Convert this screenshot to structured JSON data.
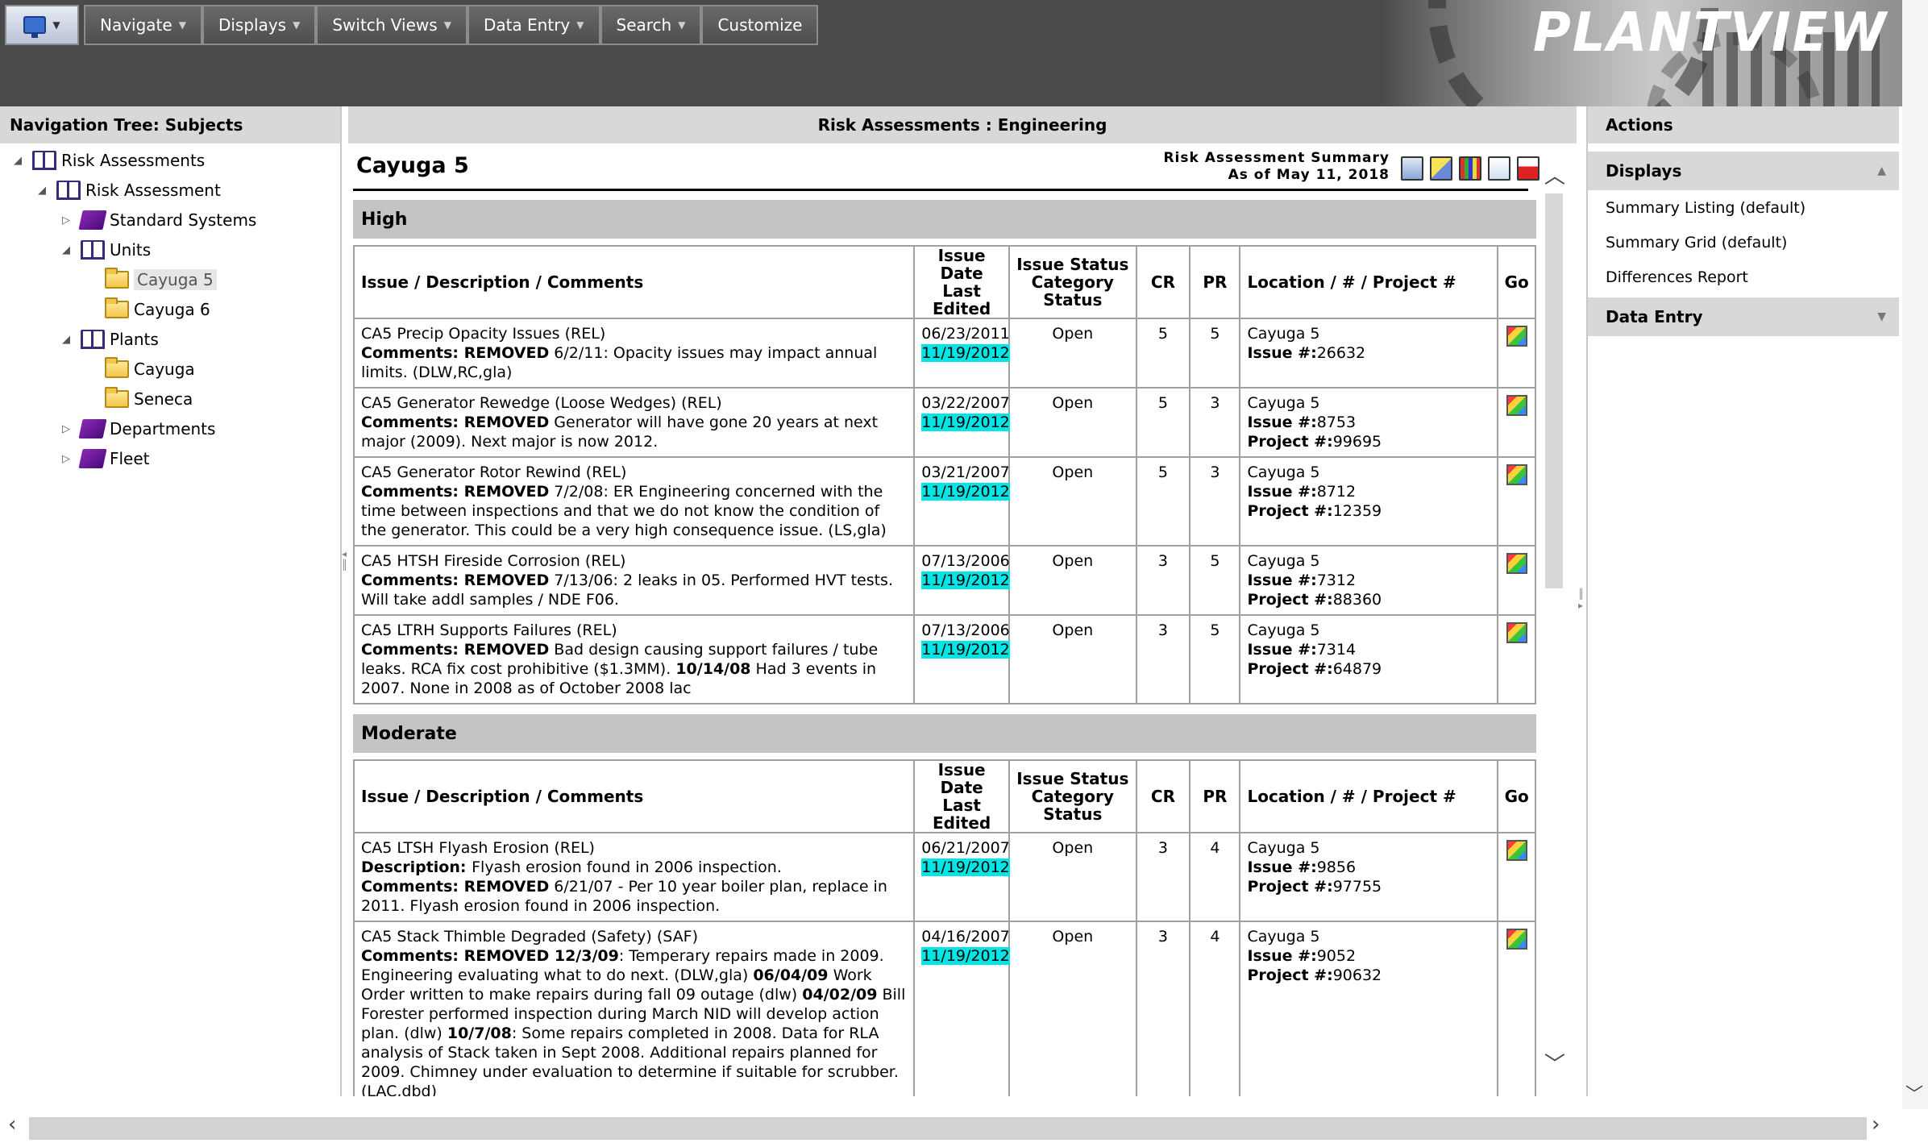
{
  "menu": {
    "items": [
      {
        "label": "Navigate",
        "arrow": true
      },
      {
        "label": "Displays",
        "arrow": true
      },
      {
        "label": "Switch Views",
        "arrow": true
      },
      {
        "label": "Data Entry",
        "arrow": true
      },
      {
        "label": "Search",
        "arrow": true
      },
      {
        "label": "Customize",
        "arrow": false
      }
    ]
  },
  "logo": "PLANTVIEW",
  "nav_tree": {
    "title": "Navigation Tree: Subjects",
    "nodes": [
      {
        "label": "Risk Assessments",
        "icon": "book-icon",
        "level": 0,
        "toggle": "expanded"
      },
      {
        "label": "Risk Assessment",
        "icon": "book-icon",
        "level": 1,
        "toggle": "expanded"
      },
      {
        "label": "Standard Systems",
        "icon": "purple-book-icon",
        "level": 2,
        "toggle": "collapsed"
      },
      {
        "label": "Units",
        "icon": "book-icon",
        "level": 2,
        "toggle": "expanded"
      },
      {
        "label": "Cayuga 5",
        "icon": "folder-icon",
        "level": 3,
        "toggle": "none",
        "selected": true
      },
      {
        "label": "Cayuga 6",
        "icon": "folder-icon",
        "level": 3,
        "toggle": "none"
      },
      {
        "label": "Plants",
        "icon": "book-icon",
        "level": 2,
        "toggle": "expanded"
      },
      {
        "label": "Cayuga",
        "icon": "folder-icon",
        "level": 3,
        "toggle": "none"
      },
      {
        "label": "Seneca",
        "icon": "folder-icon",
        "level": 3,
        "toggle": "none"
      },
      {
        "label": "Departments",
        "icon": "purple-book-icon",
        "level": 2,
        "toggle": "collapsed"
      },
      {
        "label": "Fleet",
        "icon": "purple-book-icon",
        "level": 2,
        "toggle": "collapsed"
      }
    ]
  },
  "center": {
    "title": "Risk Assessments : Engineering",
    "subject": "Cayuga 5",
    "summary_line1": "Risk Assessment Summary",
    "summary_line2": "As of May 11, 2018",
    "columns": {
      "issue": "Issue / Description / Comments",
      "date1": "Issue Date",
      "date2": "Last Edited",
      "status1": "Issue Status",
      "status2": "Category Status",
      "cr": "CR",
      "pr": "PR",
      "location": "Location / # / Project #",
      "go": "Go"
    },
    "groups": [
      {
        "name": "High",
        "rows": [
          {
            "issue": "CA5 Precip Opacity Issues (REL)",
            "lines": [
              [
                {
                  "b": "Comments: "
                },
                {
                  "b": "REMOVED"
                },
                {
                  "t": " 6/2/11: Opacity issues may impact annual limits. (DLW,RC,gla)"
                }
              ]
            ],
            "issue_date": "06/23/2011",
            "last_edited": "11/19/2012",
            "status": "Open",
            "cr": "5",
            "pr": "5",
            "location": "Cayuga 5",
            "issue_no": "26632",
            "project_no": ""
          },
          {
            "issue": "CA5 Generator Rewedge (Loose Wedges) (REL)",
            "lines": [
              [
                {
                  "b": "Comments: "
                },
                {
                  "b": "REMOVED"
                },
                {
                  "t": " Generator will have gone 20 years at next major (2009).  Next major is now 2012."
                }
              ]
            ],
            "issue_date": "03/22/2007",
            "last_edited": "11/19/2012",
            "status": "Open",
            "cr": "5",
            "pr": "3",
            "location": "Cayuga 5",
            "issue_no": "8753",
            "project_no": "99695"
          },
          {
            "issue": "CA5 Generator Rotor Rewind (REL)",
            "lines": [
              [
                {
                  "b": "Comments: "
                },
                {
                  "b": "REMOVED"
                },
                {
                  "t": "  7/2/08: ER Engineering concerned with the time between inspections and that we do not know the condition of the generator. This could be a very high consequence issue. (LS,gla)"
                }
              ]
            ],
            "issue_date": "03/21/2007",
            "last_edited": "11/19/2012",
            "status": "Open",
            "cr": "5",
            "pr": "3",
            "location": "Cayuga 5",
            "issue_no": "8712",
            "project_no": "12359"
          },
          {
            "issue": "CA5 HTSH Fireside Corrosion (REL)",
            "lines": [
              [
                {
                  "b": "Comments: "
                },
                {
                  "b": "REMOVED"
                },
                {
                  "t": " 7/13/06: 2 leaks in 05. Performed HVT tests. Will take addl samples / NDE F06."
                }
              ]
            ],
            "issue_date": "07/13/2006",
            "last_edited": "11/19/2012",
            "status": "Open",
            "cr": "3",
            "pr": "5",
            "location": "Cayuga 5",
            "issue_no": "7312",
            "project_no": "88360"
          },
          {
            "issue": "CA5 LTRH Supports Failures (REL)",
            "lines": [
              [
                {
                  "b": "Comments: "
                },
                {
                  "b": "REMOVED"
                },
                {
                  "t": " Bad design causing support failures / tube leaks. RCA fix cost prohibitive ($1.3MM).  "
                },
                {
                  "b": "10/14/08"
                },
                {
                  "t": " Had 3 events in 2007. None in 2008 as of October 2008 lac"
                }
              ]
            ],
            "issue_date": "07/13/2006",
            "last_edited": "11/19/2012",
            "status": "Open",
            "cr": "3",
            "pr": "5",
            "location": "Cayuga 5",
            "issue_no": "7314",
            "project_no": "64879"
          }
        ]
      },
      {
        "name": "Moderate",
        "rows": [
          {
            "issue": "CA5 LTSH Flyash Erosion (REL)",
            "lines": [
              [
                {
                  "b": "Description: "
                },
                {
                  "t": "Flyash erosion found in 2006 inspection."
                }
              ],
              [
                {
                  "b": "Comments: "
                },
                {
                  "b": "REMOVED"
                },
                {
                  "t": " 6/21/07 - Per 10 year boiler plan, replace in 2011. Flyash erosion found in 2006 inspection."
                }
              ]
            ],
            "issue_date": "06/21/2007",
            "last_edited": "11/19/2012",
            "status": "Open",
            "cr": "3",
            "pr": "4",
            "location": "Cayuga 5",
            "issue_no": "9856",
            "project_no": "97755"
          },
          {
            "issue": "CA5 Stack Thimble Degraded (Safety) (SAF)",
            "lines": [
              [
                {
                  "b": "Comments: "
                },
                {
                  "b": "REMOVED 12/3/09"
                },
                {
                  "t": ": Temperary repairs made in 2009.  Engineering evaluating what to do next. (DLW,gla) "
                },
                {
                  "b": "06/04/09"
                },
                {
                  "t": " Work Order written to make repairs during fall 09 outage (dlw)  "
                },
                {
                  "b": "04/02/09"
                },
                {
                  "t": " Bill Forester performed inspection during March NID will develop action plan. (dlw)  "
                },
                {
                  "b": "10/7/08"
                },
                {
                  "t": ": Some repairs completed in 2008.  Data for RLA analysis of Stack taken in Sept 2008. Additional repairs planned for 2009.  Chimney under evaluation to determine if suitable for scrubber. (LAC,dbd)"
                }
              ]
            ],
            "issue_date": "04/16/2007",
            "last_edited": "11/19/2012",
            "status": "Open",
            "cr": "3",
            "pr": "4",
            "location": "Cayuga 5",
            "issue_no": "9052",
            "project_no": "90632"
          }
        ]
      }
    ],
    "labels": {
      "issue_no": "Issue #:",
      "project_no": "Project #:"
    }
  },
  "actions": {
    "title": "Actions",
    "displays_header": "Displays",
    "display_items": [
      "Summary Listing (default)",
      "Summary Grid (default)",
      "Differences Report"
    ],
    "data_entry_header": "Data Entry"
  }
}
